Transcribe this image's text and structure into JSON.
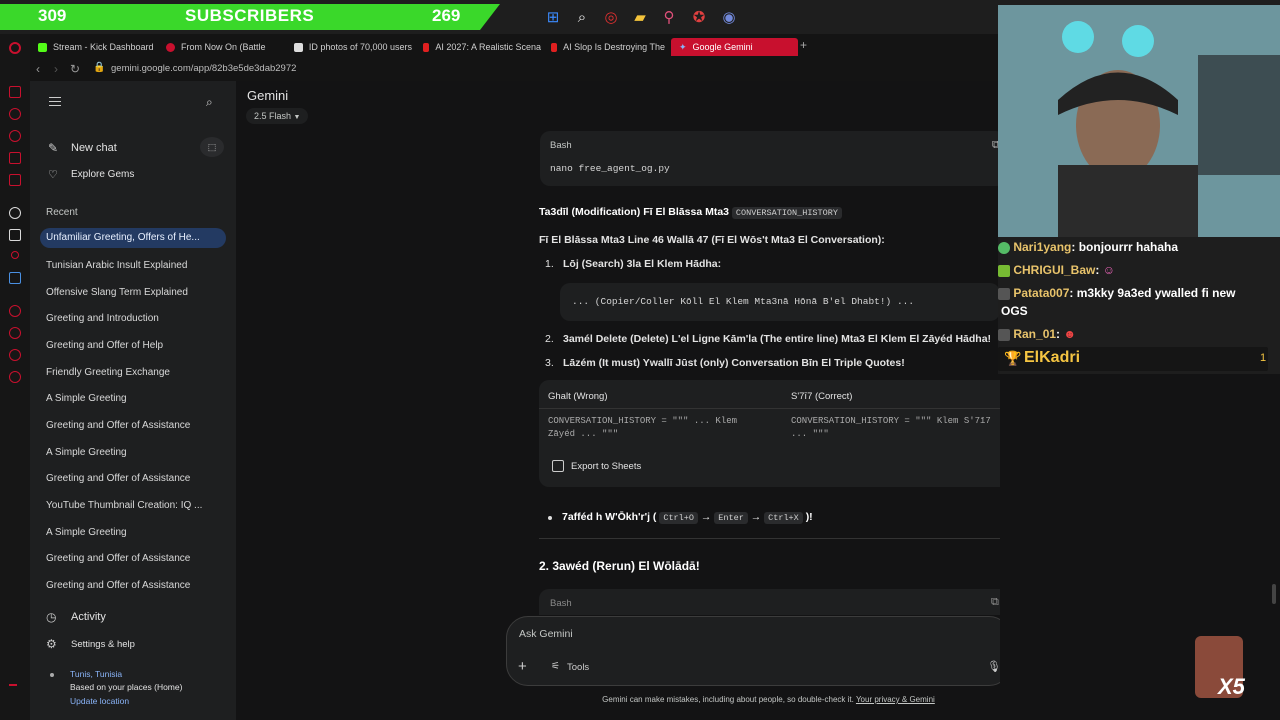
{
  "overlay": {
    "sub_left": "309",
    "sub_label": "SUBSCRIBERS",
    "sub_right": "269",
    "cam_badge": "X5"
  },
  "tabs": [
    {
      "label": "Stream - Kick Dashboard",
      "color": "#53fc18"
    },
    {
      "label": "From Now On (Battle",
      "color": "#c8102e"
    },
    {
      "label": "ID photos of 70,000 users",
      "color": "#dddddd"
    },
    {
      "label": "AI 2027: A Realistic Scena",
      "color": "#e02020"
    },
    {
      "label": "AI Slop Is Destroying The",
      "color": "#e02020"
    },
    {
      "label": "Google Gemini",
      "color": "#8ab4f8"
    }
  ],
  "address": {
    "url": "gemini.google.com/app/82b3e5de3dab2972"
  },
  "sidebar": {
    "new_chat": "New chat",
    "explore": "Explore Gems",
    "recent_label": "Recent",
    "recent": [
      "Unfamiliar Greeting, Offers of He...",
      "Tunisian Arabic Insult Explained",
      "Offensive Slang Term Explained",
      "Greeting and Introduction",
      "Greeting and Offer of Help",
      "Friendly Greeting Exchange",
      "A Simple Greeting",
      "Greeting and Offer of Assistance",
      "A Simple Greeting",
      "Greeting and Offer of Assistance",
      "YouTube Thumbnail Creation: IQ ...",
      "A Simple Greeting",
      "Greeting and Offer of Assistance",
      "Greeting and Offer of Assistance"
    ],
    "activity": "Activity",
    "settings": "Settings & help",
    "location_city": "Tunis, Tunisia",
    "location_basis": "Based on your places (Home)",
    "update_location": "Update location"
  },
  "header": {
    "title": "Gemini",
    "model": "2.5 Flash"
  },
  "content": {
    "code1_lang": "Bash",
    "code1": "nano free_agent_og.py",
    "h1_pre": "Ta3dīl (Modification) Fī El Blāssa Mta3",
    "h1_code": "CONVERSATION_HISTORY",
    "p1": "Fī El Blāssa Mta3 Line 46 Wallā 47 (Fī El Wōs't Mta3 El Conversation):",
    "li1": "Lōj (Search) 3la El Klem Hādha:",
    "code2": "... (Copier/Coller Kōll El Klem Mta3nā Hōnā B'el Dhabt!) ...",
    "li2": "3amél Delete (Delete) L'el Ligne Kām'la (The entire line) Mta3 El Klem El Zāyéd Hādha!",
    "li3": "Lāzém (It must) Ywallī Jūst (only) Conversation Bīn El Triple Quotes!",
    "table_h_wrong": "Ghalt (Wrong)",
    "table_h_correct": "S'7ī7 (Correct)",
    "table_wrong": "CONVERSATION_HISTORY = \"\"\" ... Klem Zāyéd ... \"\"\"",
    "table_correct": "CONVERSATION_HISTORY = \"\"\" Klem S'7ī7 ... \"\"\"",
    "export": "Export to Sheets",
    "bullet_pre": "7afféd h W'Ōkh'r'j (",
    "key1": "Ctrl+O",
    "key2": "Enter",
    "key3": "Ctrl+X",
    "bullet_post": ")!",
    "h2": "2. 3awéd (Rerun) El Wōlādā!",
    "code3_lang": "Bash"
  },
  "input": {
    "placeholder": "Ask Gemini",
    "tools": "Tools"
  },
  "footer": {
    "disclaimer": "Gemini can make mistakes, including about people, so double-check it. ",
    "link": "Your privacy & Gemini"
  },
  "chat": [
    {
      "user": "Nari1yang",
      "msg": ": bonjourrr hahaha"
    },
    {
      "user": "CHRIGUI_Baw",
      "msg": ":"
    },
    {
      "user": "Patata007",
      "msg": ": m3kky 9a3ed ywalled fi new"
    },
    {
      "user": "",
      "msg": "OGS"
    },
    {
      "user": "Ran_01",
      "msg": ":"
    }
  ],
  "leader": {
    "name": "ElKadri",
    "rank": "1"
  },
  "colors": {
    "accent": "#8ab4f8",
    "selected": "#233a62",
    "opera_red": "#c8102e",
    "sub_green": "#3ad82a"
  }
}
